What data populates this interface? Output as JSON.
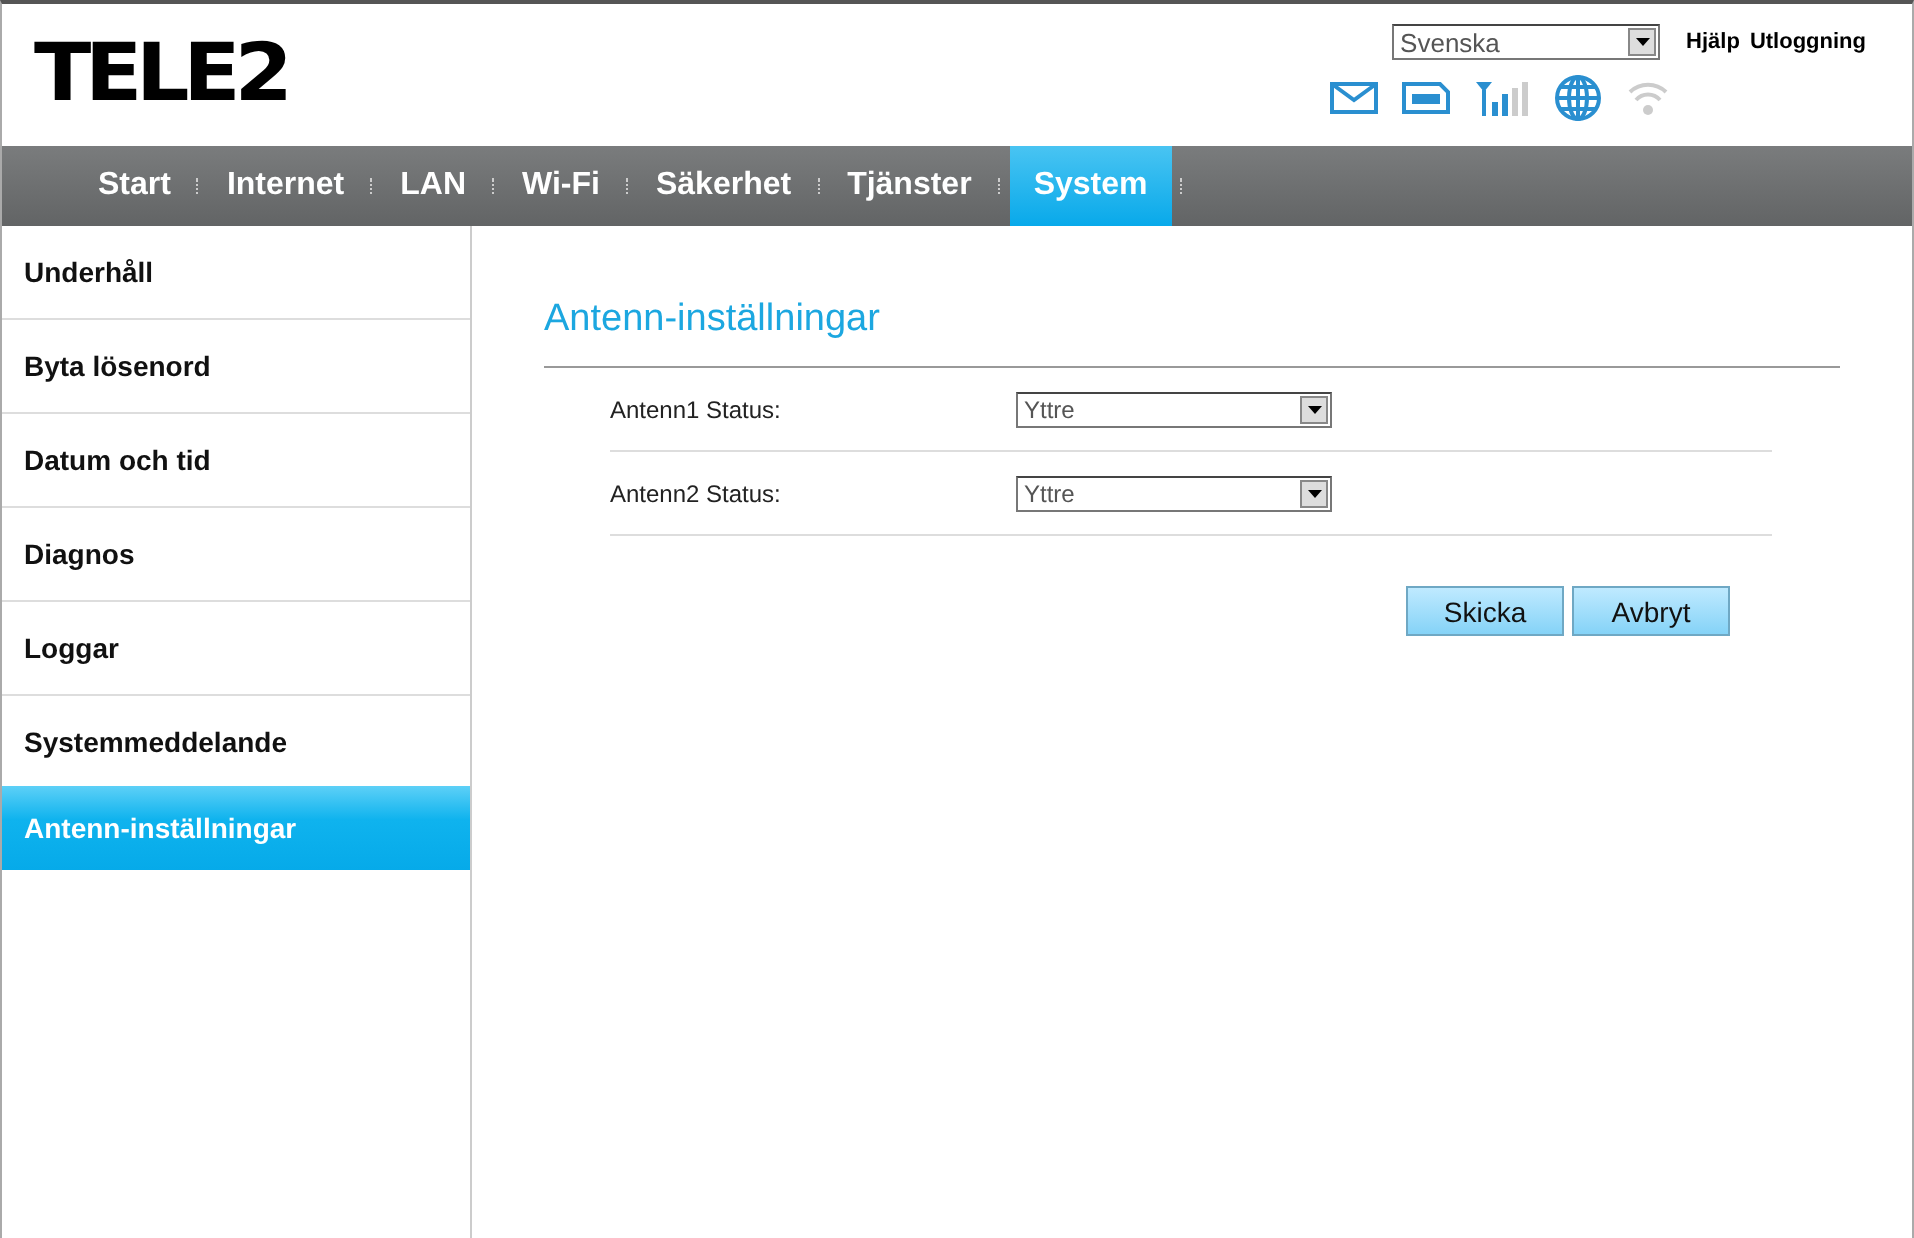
{
  "logo": "TELE2",
  "language": {
    "value": "Svenska"
  },
  "header_links": [
    "Hjälp",
    "Utloggning"
  ],
  "nav": [
    {
      "label": "Start",
      "selected": false
    },
    {
      "label": "Internet",
      "selected": false
    },
    {
      "label": "LAN",
      "selected": false
    },
    {
      "label": "Wi-Fi",
      "selected": false
    },
    {
      "label": "Säkerhet",
      "selected": false
    },
    {
      "label": "Tjänster",
      "selected": false
    },
    {
      "label": "System",
      "selected": true
    }
  ],
  "sidebar": {
    "items": [
      {
        "label": "Underhåll",
        "selected": false
      },
      {
        "label": "Byta lösenord",
        "selected": false
      },
      {
        "label": "Datum och tid",
        "selected": false
      },
      {
        "label": "Diagnos",
        "selected": false
      },
      {
        "label": "Loggar",
        "selected": false
      },
      {
        "label": "Systemmeddelande",
        "selected": false
      },
      {
        "label": "Antenn-inställningar",
        "selected": true
      }
    ]
  },
  "title": "Antenn-inställningar",
  "fields": [
    {
      "label": "Antenn1 Status:",
      "value": "Yttre"
    },
    {
      "label": "Antenn2 Status:",
      "value": "Yttre"
    }
  ],
  "buttons": [
    "Skicka",
    "Avbryt"
  ]
}
